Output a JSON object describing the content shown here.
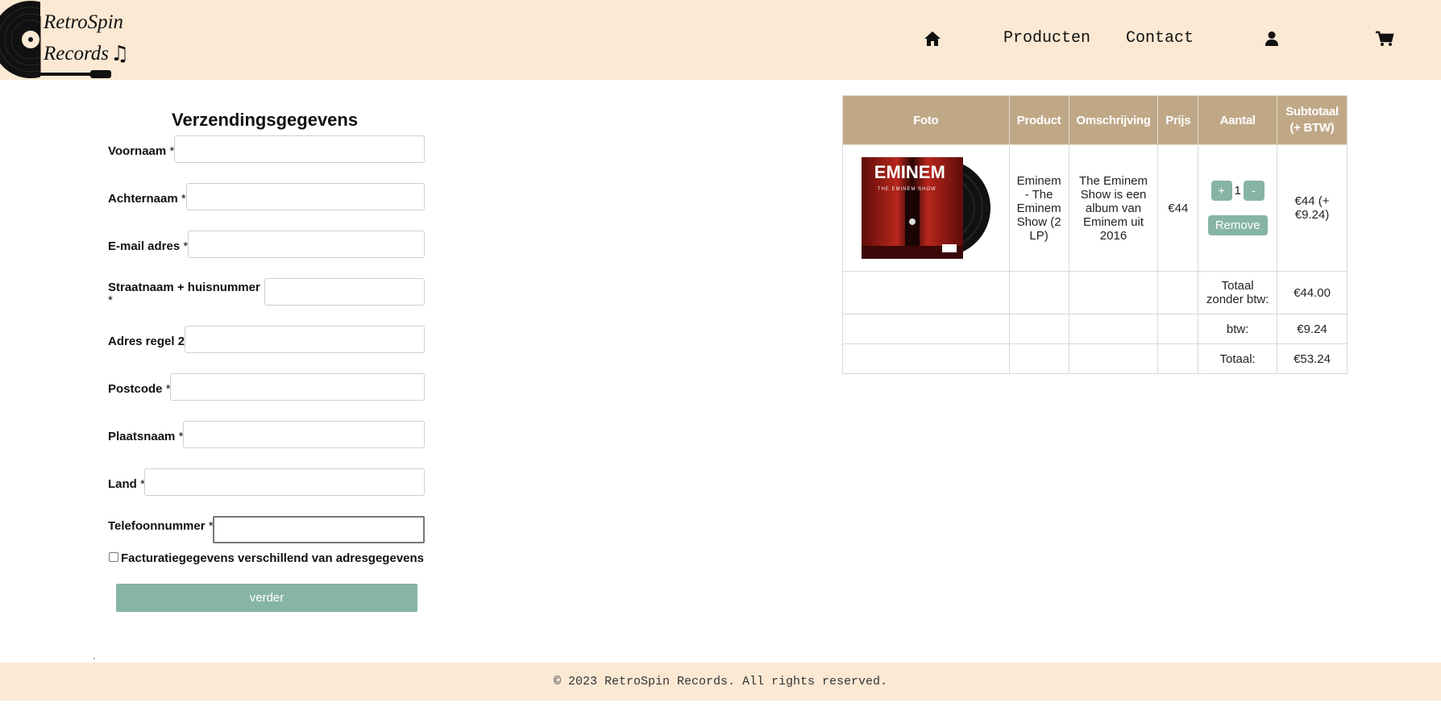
{
  "header": {
    "logo_line1": "RetroSpin",
    "logo_line2": "Records",
    "nav": {
      "home_icon": "home-icon",
      "producten": "Producten",
      "contact": "Contact",
      "account_icon": "user-icon",
      "cart_icon": "cart-icon"
    }
  },
  "form": {
    "title": "Verzendingsgegevens",
    "required_mark": "*",
    "fields": {
      "voornaam": {
        "label": "Voornaam",
        "value": ""
      },
      "achternaam": {
        "label": "Achternaam",
        "value": ""
      },
      "email": {
        "label": "E-mail adres",
        "value": ""
      },
      "straat": {
        "label": "Straatnaam + huisnummer",
        "value": ""
      },
      "adres2": {
        "label": "Adres regel 2",
        "value": ""
      },
      "postcode": {
        "label": "Postcode",
        "value": ""
      },
      "plaats": {
        "label": "Plaatsnaam",
        "value": ""
      },
      "land": {
        "label": "Land",
        "value": ""
      },
      "telefoon": {
        "label": "Telefoonnummer",
        "value": ""
      }
    },
    "billing_checkbox_label": "Facturatiegegevens verschillend van adresgegevens",
    "billing_checked": false,
    "submit_label": "verder"
  },
  "cart": {
    "headers": {
      "foto": "Foto",
      "product": "Product",
      "omschrijving": "Omschrijving",
      "prijs": "Prijs",
      "aantal": "Aantal",
      "subtotaal_1": "Subtotaal",
      "subtotaal_2": "(+ BTW)"
    },
    "item": {
      "cover_text": "EMINEM",
      "cover_subtext": "THE EMINEM SHOW",
      "product": "Eminem - The Eminem Show (2 LP)",
      "description": "The Eminem Show is een album van Eminem uit 2016",
      "price": "€44",
      "qty_plus": "+",
      "qty": "1",
      "qty_minus": "-",
      "remove": "Remove",
      "subtotal": "€44 (+ €9.24)"
    },
    "totals": {
      "excl_label": "Totaal zonder btw:",
      "excl_value": "€44.00",
      "btw_label": "btw:",
      "btw_value": "€9.24",
      "total_label": "Totaal:",
      "total_value": "€53.24"
    }
  },
  "footer": {
    "copyright": "© 2023 RetroSpin Records. All rights reserved."
  },
  "colors": {
    "header_bg": "#fbe9d4",
    "table_header": "#c0a887",
    "accent_button": "#86b5a3"
  }
}
